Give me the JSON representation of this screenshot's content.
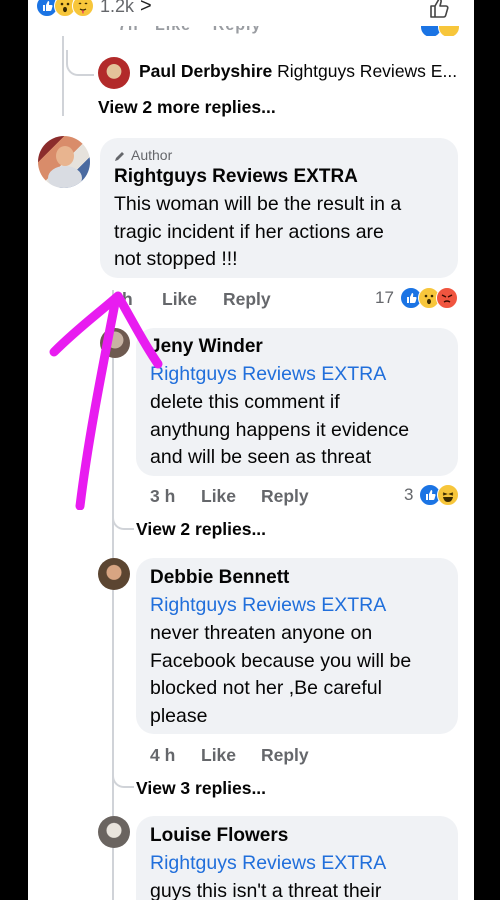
{
  "top_bar": {
    "reaction_count": "1.2k",
    "chevron": ">",
    "icon": "thumbs-up-outline-icon"
  },
  "comments": [
    {
      "id": "paul",
      "name": "Paul Derbyshire",
      "preview": "Rightguys Reviews E...",
      "view_replies": "View 2 more replies..."
    },
    {
      "id": "author",
      "badge": "Author",
      "name": "Rightguys Reviews EXTRA",
      "lines": [
        "This woman will be the result in a",
        "tragic incident  if her actions are",
        "not stopped !!!"
      ],
      "time": "h",
      "like": "Like",
      "reply": "Reply",
      "reaction_count": "17"
    },
    {
      "id": "jeny",
      "name": "Jeny Winder",
      "mention": "Rightguys Reviews EXTRA",
      "lines": [
        "delete this comment if",
        "anythung happens it evidence",
        "and will be seen as threat"
      ],
      "time": "3 h",
      "like": "Like",
      "reply": "Reply",
      "reaction_count": "3",
      "view_replies": "View 2 replies..."
    },
    {
      "id": "debbie",
      "name": "Debbie Bennett",
      "mention": "Rightguys Reviews EXTRA",
      "lines": [
        "never threaten anyone on",
        "Facebook because you will be",
        "blocked not her ,Be careful",
        "please"
      ],
      "time": "4 h",
      "like": "Like",
      "reply": "Reply",
      "view_replies": "View 3 replies..."
    },
    {
      "id": "louise",
      "name": "Louise Flowers",
      "mention": "Rightguys Reviews EXTRA",
      "lines": [
        "guys this isn't a threat their"
      ]
    }
  ],
  "annotation": {
    "color": "#e81cf0",
    "shape": "hand-drawn-arrow"
  },
  "colors": {
    "link": "#216fdb",
    "bubble": "#f0f2f5",
    "meta": "#65676b",
    "like": "#1b74e4"
  }
}
